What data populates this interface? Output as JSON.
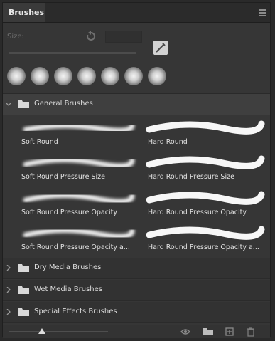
{
  "panel": {
    "tab_label": "Brushes",
    "size_label": "Size:"
  },
  "groups": [
    {
      "label": "General Brushes",
      "expanded": true,
      "brushes": [
        {
          "label": "Soft Round"
        },
        {
          "label": "Hard Round"
        },
        {
          "label": "Soft Round Pressure Size"
        },
        {
          "label": "Hard Round Pressure Size"
        },
        {
          "label": "Soft Round Pressure Opacity"
        },
        {
          "label": "Hard Round Pressure Opacity"
        },
        {
          "label": "Soft Round Pressure Opacity a..."
        },
        {
          "label": "Hard Round Pressure Opacity a..."
        }
      ]
    },
    {
      "label": "Dry Media Brushes",
      "expanded": false
    },
    {
      "label": "Wet Media Brushes",
      "expanded": false
    },
    {
      "label": "Special Effects Brushes",
      "expanded": false
    }
  ],
  "icons": {
    "panel_menu": "menu-icon",
    "reset": "reset-icon",
    "new_preset": "new-preset-icon",
    "folder": "folder-icon",
    "visibility": "eye-icon",
    "new_group": "new-folder-icon",
    "new_brush": "new-brush-icon",
    "delete": "trash-icon"
  }
}
